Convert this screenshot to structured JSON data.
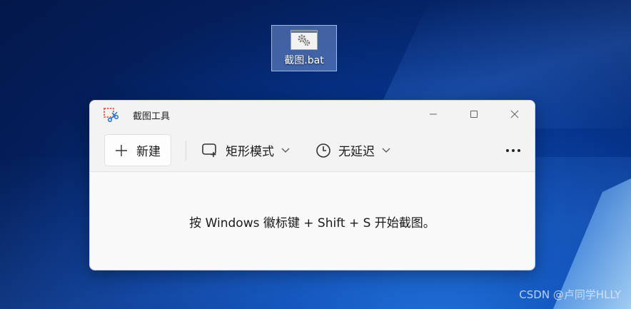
{
  "desktop": {
    "icon_label": "截图.bat",
    "watermark": "CSDN @卢同学HLLY"
  },
  "window": {
    "title": "截图工具",
    "controls": {
      "minimize": "minimize-icon",
      "maximize": "maximize-icon",
      "close": "close-icon"
    }
  },
  "toolbar": {
    "new_label": "新建",
    "mode_label": "矩形模式",
    "delay_label": "无延迟"
  },
  "content": {
    "hint": "按 Windows 徽标键 + Shift + S 开始截图。"
  },
  "colors": {
    "desktop_bg": "#06338a",
    "window_bg": "#f9f9f9",
    "titlebar_bg": "#f3f3f3"
  }
}
